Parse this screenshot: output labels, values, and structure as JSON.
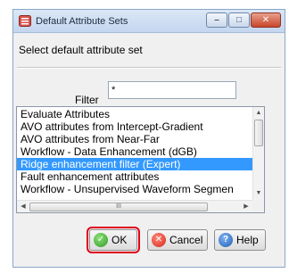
{
  "window": {
    "title": "Default Attribute Sets",
    "controls": {
      "minimize_icon": "minimize-icon",
      "maximize_icon": "maximize-icon",
      "close_icon": "close-icon"
    }
  },
  "prompt": "Select default attribute set",
  "filter": {
    "label": "Filter",
    "value": "*"
  },
  "list": {
    "items": [
      "Evaluate Attributes",
      "AVO attributes from Intercept-Gradient",
      "AVO attributes from Near-Far",
      "Workflow - Data Enhancement (dGB)",
      "Ridge enhancement filter (Expert)",
      "Fault enhancement attributes",
      "Workflow - Unsupervised Waveform Segmen"
    ],
    "selected_index": 4,
    "hscroll_grip": "III"
  },
  "buttons": {
    "ok": "OK",
    "cancel": "Cancel",
    "help": "Help"
  },
  "colors": {
    "selection": "#3399ff",
    "highlight_outline": "#e0001b"
  }
}
